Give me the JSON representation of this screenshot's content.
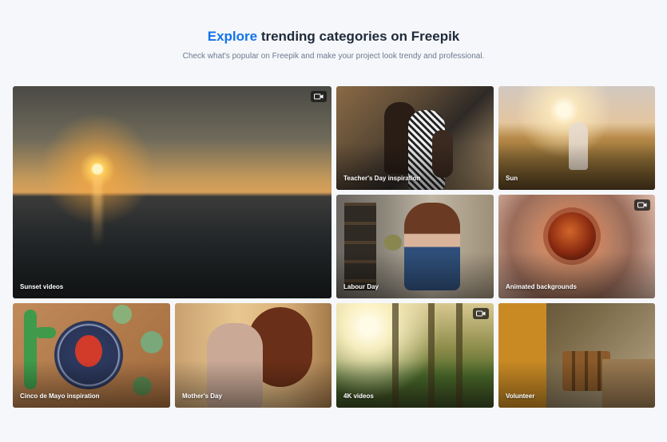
{
  "header": {
    "title_accent": "Explore",
    "title_rest": " trending categories on Freepik",
    "subtitle": "Check what's popular on Freepik and make your project look trendy and professional."
  },
  "colors": {
    "accent": "#1273eb",
    "title": "#1f2a3a",
    "subtitle": "#6b7a8f",
    "background": "#f5f7fa"
  },
  "tiles": [
    {
      "label": "Sunset videos",
      "video": true
    },
    {
      "label": "Teacher's Day inspiration",
      "video": false
    },
    {
      "label": "Sun",
      "video": false
    },
    {
      "label": "Labour Day",
      "video": false
    },
    {
      "label": "Animated backgrounds",
      "video": true
    },
    {
      "label": "Cinco de Mayo inspiration",
      "video": false
    },
    {
      "label": "Mother's Day",
      "video": false
    },
    {
      "label": "4K videos",
      "video": true
    },
    {
      "label": "Volunteer",
      "video": false
    }
  ],
  "icons": {
    "video_badge": "video-camera-icon"
  }
}
